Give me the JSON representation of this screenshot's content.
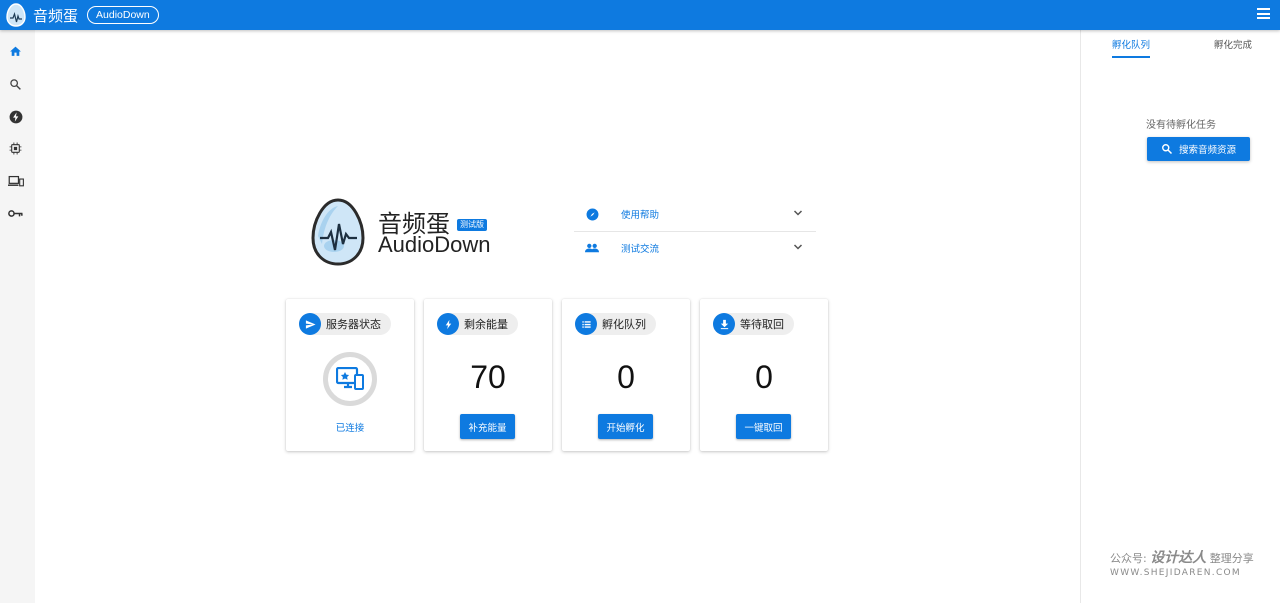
{
  "header": {
    "app_name": "音频蛋",
    "app_tag": "AudioDown"
  },
  "sidebar": {
    "icons": [
      "home-icon",
      "search-icon",
      "lightning-icon",
      "chip-icon",
      "devices-icon",
      "key-icon"
    ]
  },
  "hero": {
    "name_cn": "音频蛋",
    "badge": "测试版",
    "name_en": "AudioDown"
  },
  "accordion": [
    {
      "label": "使用帮助",
      "icon": "compass-icon"
    },
    {
      "label": "测试交流",
      "icon": "people-icon"
    }
  ],
  "cards": {
    "server": {
      "title": "服务器状态",
      "status": "已连接"
    },
    "energy": {
      "title": "剩余能量",
      "value": "70",
      "button": "补充能量"
    },
    "queue": {
      "title": "孵化队列",
      "value": "0",
      "button": "开始孵化"
    },
    "retrieve": {
      "title": "等待取回",
      "value": "0",
      "button": "一键取回"
    }
  },
  "right_panel": {
    "tabs": [
      "孵化队列",
      "孵化完成"
    ],
    "empty_text": "没有待孵化任务",
    "search_button": "搜索音频资源"
  },
  "watermark": {
    "line1_prefix": "公众号:",
    "line1_brand": "设计达人",
    "line1_suffix": "整理分享",
    "line2": "WWW.SHEJIDAREN.COM"
  },
  "colors": {
    "primary": "#0e7ae0"
  }
}
